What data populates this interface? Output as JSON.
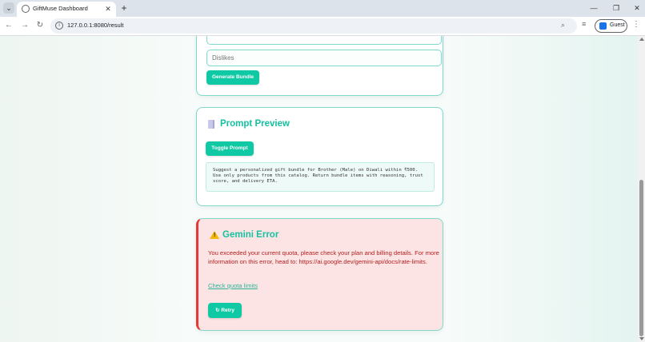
{
  "browser": {
    "tab_title": "GiftMuse Dashboard",
    "tab_close": "✕",
    "new_tab": "+",
    "url": "127.0.0.1:8080/result",
    "profile_label": "Guest",
    "window_controls": {
      "minimize": "—",
      "restore": "❐",
      "close": "✕"
    }
  },
  "form": {
    "dislikes_placeholder": "Dislikes",
    "generate_label": "Generate Bundle"
  },
  "prompt_preview": {
    "icon": "document-icon",
    "title": "Prompt Preview",
    "toggle_label": "Toggle Prompt",
    "text": "Suggest a personalized gift bundle for Brother (Male) on Diwali within ₹500.\nUse only products from this catalog. Return bundle items with reasoning, trust\nscore, and delivery ETA."
  },
  "error": {
    "icon": "warning-icon",
    "title": "Gemini Error",
    "message": "You exceeded your current quota, please check your plan and billing details. For more information on this error, head to: https://ai.google.dev/gemini-api/docs/rate-limits.",
    "link_label": "Check quota limits",
    "retry_label": "↻ Retry"
  },
  "colors": {
    "accent": "#0fc9a4",
    "heading": "#14c2a0",
    "error_bg": "#fde4e4",
    "error_text": "#b32020",
    "error_border": "#e53935"
  }
}
